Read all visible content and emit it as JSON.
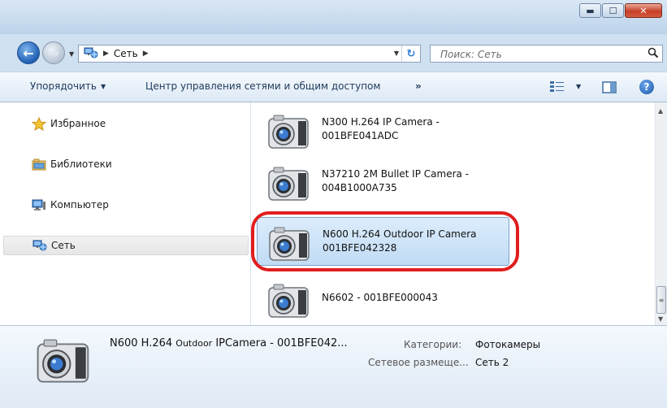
{
  "address": {
    "crumbs": [
      "Сеть"
    ],
    "search_placeholder": "Поиск: Сеть"
  },
  "toolbar": {
    "organize_label": "Упорядочить",
    "network_center_label": "Центр управления сетями и общим доступом",
    "more_label": "»"
  },
  "nav": {
    "items": [
      {
        "label": "Избранное",
        "icon": "star-icon"
      },
      {
        "label": "Библиотеки",
        "icon": "library-icon"
      },
      {
        "label": "Компьютер",
        "icon": "computer-icon"
      },
      {
        "label": "Сеть",
        "icon": "network-icon",
        "selected": true
      }
    ]
  },
  "content": {
    "items": [
      {
        "line1": "N300 H.264 IP Camera -",
        "line2": "001BFE041ADC"
      },
      {
        "line1": "N37210 2M Bullet IP Camera -",
        "line2": "004B1000A735"
      },
      {
        "line1": "N600 H.264  Outdoor IP Camera",
        "line2": "001BFE042328",
        "selected": true
      },
      {
        "line1": "N6602 - 001BFE000043",
        "line2": ""
      }
    ]
  },
  "details": {
    "name_part1": "N600 H.264 ",
    "name_part2": "Outdoor",
    "name_part3": " IPCamera - 001BFE042...",
    "category_label": "Категории:",
    "category_value": "Фотокамеры",
    "location_label": "Сетевое размеще...",
    "location_value": "Сеть 2"
  },
  "colors": {
    "highlight": "#e11d1d",
    "selection": "#c1dcf5"
  }
}
